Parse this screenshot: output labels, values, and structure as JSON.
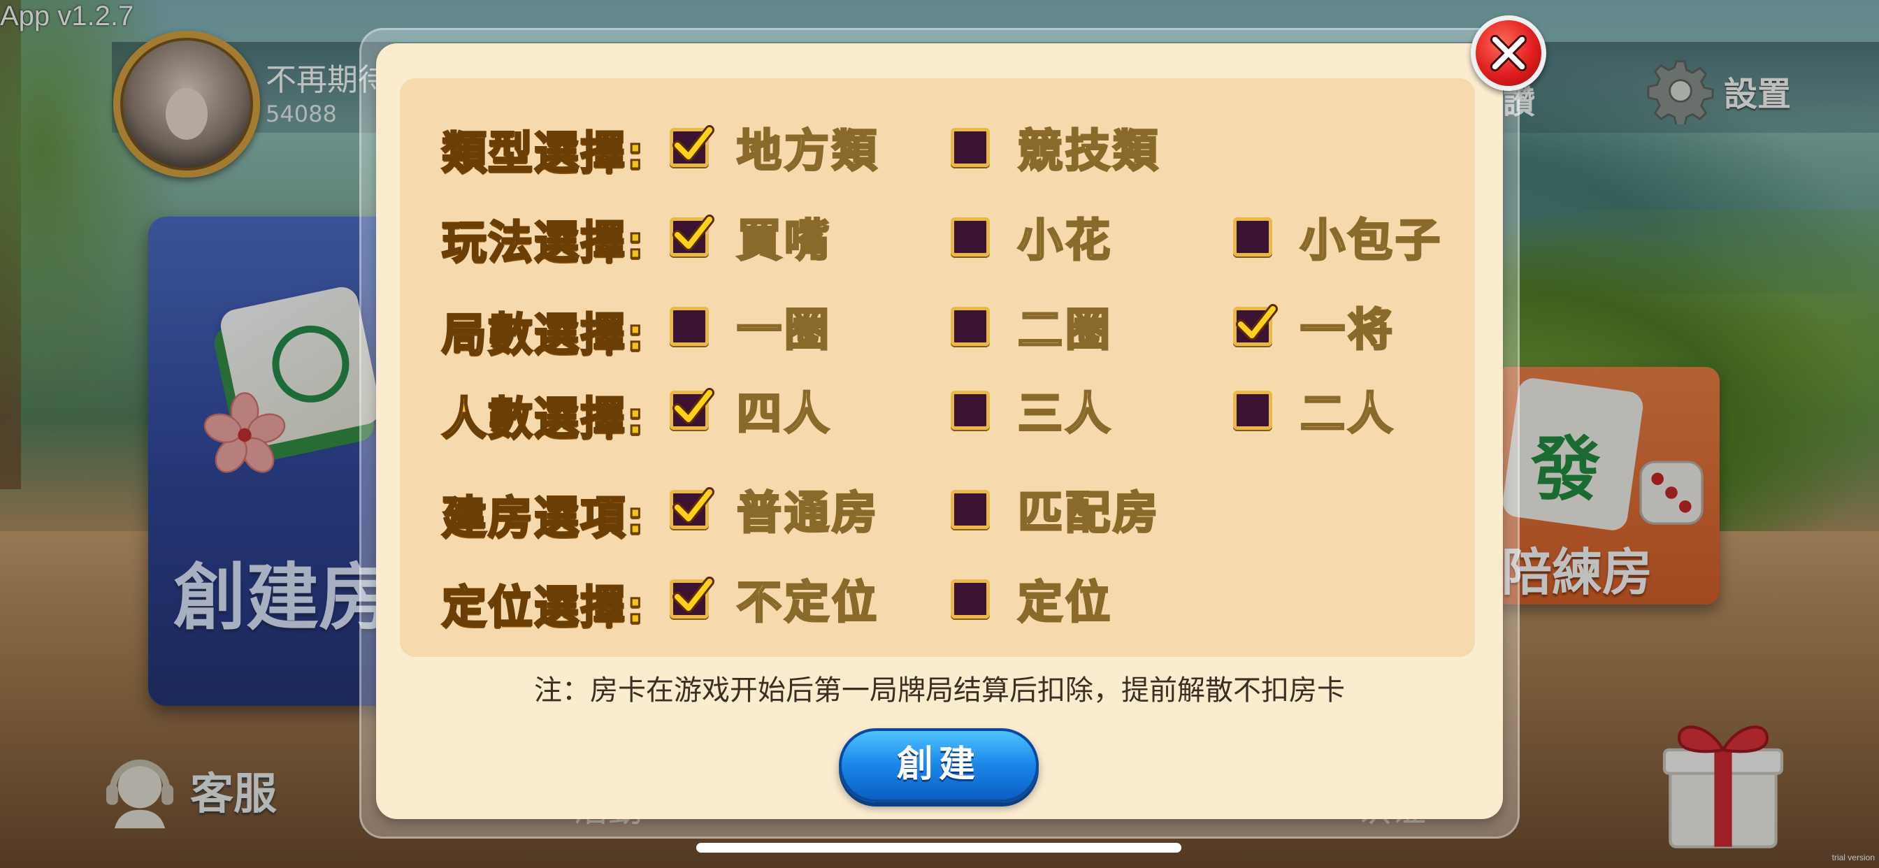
{
  "app": {
    "version": "App v1.2.7"
  },
  "player": {
    "name": "不再期待...",
    "id": "54088"
  },
  "top_menu": {
    "settings_label": "設置",
    "partial_label": "讚"
  },
  "lobby": {
    "create_room_label": "創建房",
    "practice_room_label": "陪練房",
    "practice_tile_mark": "發",
    "service_label": "客服",
    "bottom_partial_a": "活動",
    "bottom_partial_b": "认证",
    "watermark": "trial version"
  },
  "dialog": {
    "rows": [
      {
        "label": "類型選擇:",
        "options": [
          {
            "label": "地方類",
            "checked": true
          },
          {
            "label": "競技類",
            "checked": false
          }
        ]
      },
      {
        "label": "玩法選擇:",
        "options": [
          {
            "label": "買嘴",
            "checked": true
          },
          {
            "label": "小花",
            "checked": false
          },
          {
            "label": "小包子",
            "checked": false
          }
        ]
      },
      {
        "label": "局數選擇:",
        "options": [
          {
            "label": "一圈",
            "checked": false
          },
          {
            "label": "二圈",
            "checked": false
          },
          {
            "label": "一将",
            "checked": true
          }
        ]
      },
      {
        "label": "人數選擇:",
        "options": [
          {
            "label": "四人",
            "checked": true
          },
          {
            "label": "三人",
            "checked": false
          },
          {
            "label": "二人",
            "checked": false
          }
        ]
      },
      {
        "label": "建房選項:",
        "options": [
          {
            "label": "普通房",
            "checked": true
          },
          {
            "label": "匹配房",
            "checked": false
          }
        ]
      },
      {
        "label": "定位選擇:",
        "options": [
          {
            "label": "不定位",
            "checked": true
          },
          {
            "label": "定位",
            "checked": false
          }
        ]
      }
    ],
    "note": "注：房卡在游戏开始后第一局牌局结算后扣除，提前解散不扣房卡",
    "create_button": "創建"
  },
  "colors": {
    "label_gold": "#f2c418",
    "checkbox_fill": "#3b1230",
    "checkbox_border": "#e8b948",
    "check_yellow": "#ffd21a",
    "panel_bg": "#f6d9ac",
    "dialog_bg": "#fbecd0",
    "create_blue": "#1a86e8",
    "close_red": "#e01e1e"
  },
  "icons": [
    "close-icon",
    "check-icon",
    "gear-icon",
    "headset-icon",
    "gift-icon",
    "dice-icon",
    "flower-icon"
  ]
}
